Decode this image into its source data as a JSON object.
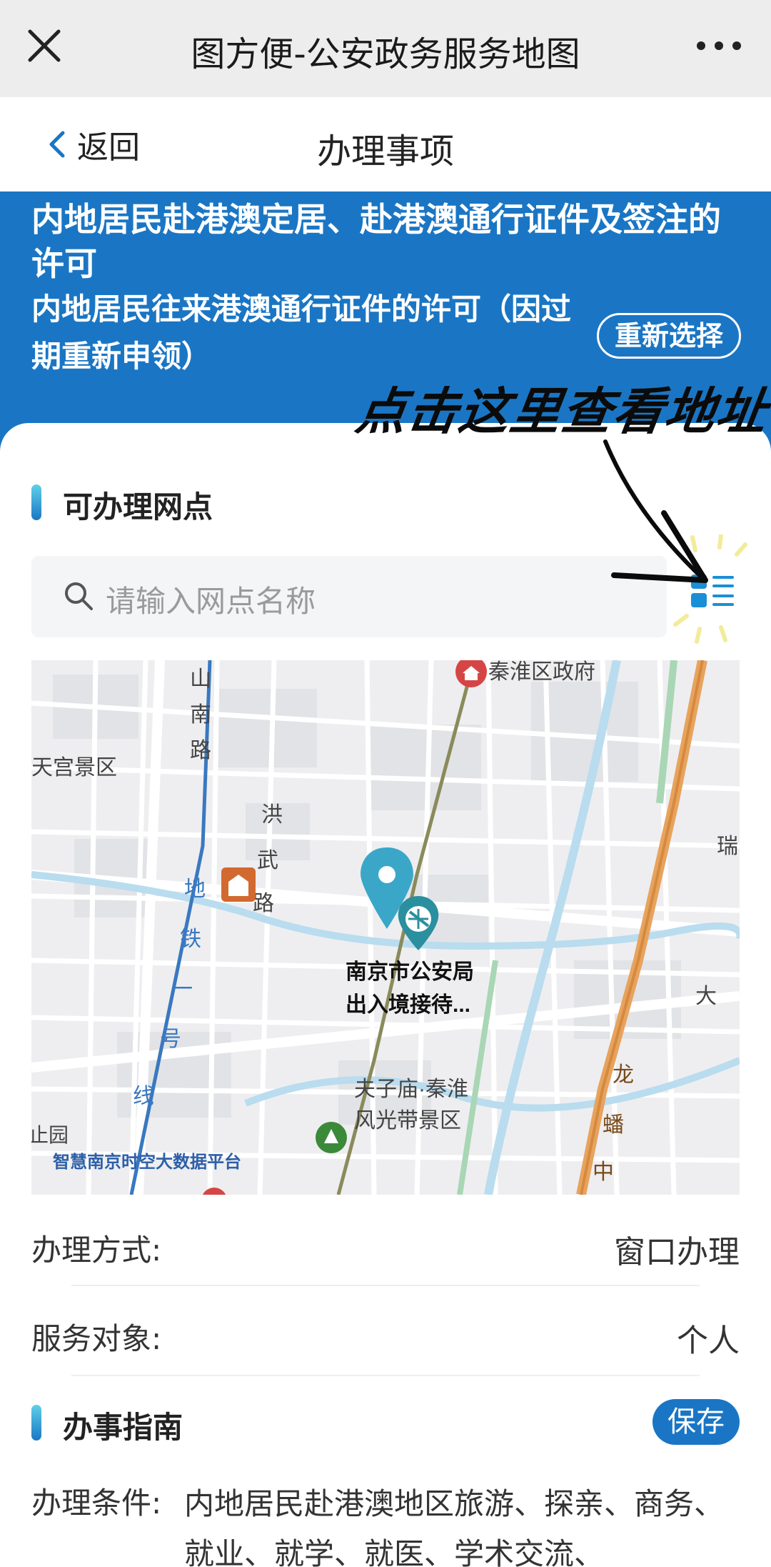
{
  "top_bar": {
    "title": "图方便-公安政务服务地图",
    "close_icon": "close-icon",
    "more_icon": "more-icon"
  },
  "nav": {
    "back_label": "返回",
    "title": "办理事项"
  },
  "banner": {
    "item_title": "内地居民赴港澳定居、赴港澳通行证件及签注的许可",
    "sub_title": "内地居民往来港澳通行证件的许可（因过期重新申领）",
    "reselect_label": "重新选择"
  },
  "annotation": {
    "text": "点击这里查看地址"
  },
  "outlets": {
    "section_title": "可办理网点",
    "search_placeholder": "请输入网点名称",
    "list_view_icon": "list-view-icon"
  },
  "map": {
    "labels": {
      "qinhuai_gov": "秦淮区政府",
      "tiangong": "天宫景区",
      "shannan_road": [
        "山",
        "南",
        "路"
      ],
      "hongwu_road": [
        "洪",
        "武",
        "路"
      ],
      "metro_line1": [
        "地",
        "铁",
        "一",
        "号",
        "线"
      ],
      "marker_title_line1": "南京市公安局",
      "marker_title_line2": "出入境接待...",
      "fuzimiao_line1": "夫子庙·秦淮",
      "fuzimiao_line2": "风光带景区",
      "garden_partial": "止园",
      "watermark": "智慧南京时空大数据平台",
      "rui": "瑞",
      "da": "大",
      "long_road": [
        "龙",
        "蟠",
        "中"
      ]
    }
  },
  "details": {
    "method_label": "办理方式:",
    "method_value": "窗口办理",
    "target_label": "服务对象:",
    "target_value": "个人"
  },
  "guide": {
    "section_title": "办事指南",
    "save_label": "保存",
    "condition_label": "办理条件:",
    "condition_text": "内地居民赴港澳地区旅游、探亲、商务、就业、就学、就医、学术交流、"
  },
  "colors": {
    "brand_blue": "#1a76c4",
    "map_pin": "#3aa7c8",
    "topbar_bg": "#ededed"
  }
}
